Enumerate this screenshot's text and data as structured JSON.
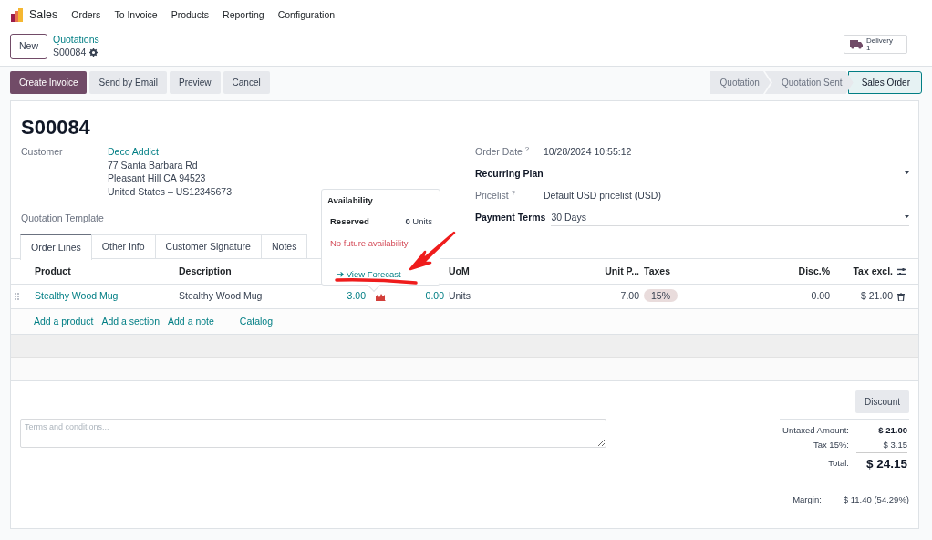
{
  "navbar": {
    "app": "Sales",
    "menus": [
      "Orders",
      "To Invoice",
      "Products",
      "Reporting",
      "Configuration"
    ]
  },
  "control_panel": {
    "new_button": "New",
    "breadcrumb": "Quotations",
    "record": "S00084",
    "smart_button": {
      "label": "Delivery",
      "count": "1"
    }
  },
  "actions": [
    {
      "label": "Create Invoice",
      "primary": true
    },
    {
      "label": "Send by Email",
      "primary": false
    },
    {
      "label": "Preview",
      "primary": false
    },
    {
      "label": "Cancel",
      "primary": false
    }
  ],
  "statusbar": [
    {
      "label": "Quotation",
      "selected": false
    },
    {
      "label": "Quotation Sent",
      "selected": false
    },
    {
      "label": "Sales Order",
      "selected": true
    }
  ],
  "title": "S00084",
  "left_fields": [
    {
      "label": "Customer",
      "link": "Deco Addict",
      "lines": [
        "77 Santa Barbara Rd",
        "Pleasant Hill CA 94523",
        "United States – US12345673"
      ]
    },
    {
      "label": "Quotation Template"
    }
  ],
  "right_fields": [
    {
      "label": "Order Date",
      "help": "?",
      "required": false,
      "kind": "readonly",
      "value": "10/28/2024 10:55:12"
    },
    {
      "label": "Recurring Plan",
      "required": true,
      "kind": "select"
    },
    {
      "label": "Pricelist",
      "help": "?",
      "required": false,
      "kind": "readonly",
      "value": "Default USD pricelist (USD)"
    },
    {
      "label": "Payment Terms",
      "required": true,
      "kind": "select",
      "value": "30 Days"
    }
  ],
  "tabs": [
    {
      "label": "Order Lines",
      "selected": true
    },
    {
      "label": "Other Info",
      "selected": false
    },
    {
      "label": "Customer Signature",
      "selected": false
    },
    {
      "label": "Notes",
      "selected": false
    }
  ],
  "columns": [
    "Product",
    "Description",
    "UoM",
    "Unit P...",
    "Taxes",
    "Disc.%",
    "Tax excl."
  ],
  "rows": [
    {
      "product": "Stealthy Wood Mug",
      "description": "Stealthy Wood Mug",
      "quantity": "3.00",
      "invoiced": "0.00",
      "uom": "Units",
      "unit_price": "7.00",
      "taxes": [
        "15%"
      ],
      "discount": "0.00",
      "subtotal": "$ 21.00"
    }
  ],
  "add_links": [
    "Add a product",
    "Add a section",
    "Add a note",
    "Catalog"
  ],
  "popover": {
    "title": "Availability",
    "reserved_label": "Reserved",
    "reserved_qty": "0",
    "reserved_unit": "Units",
    "message": "No future availability",
    "link": "➔ View Forecast"
  },
  "notes": {
    "placeholder": "Terms and conditions..."
  },
  "discount_button": "Discount",
  "totals": [
    {
      "label": "Untaxed Amount:",
      "value": "$ 21.00",
      "kind": "subtotal"
    },
    {
      "label": "Tax 15%:",
      "value": "$ 3.15",
      "kind": "tax"
    },
    {
      "label": "Total:",
      "value": "$ 24.15",
      "kind": "total"
    }
  ],
  "margin": {
    "label": "Margin:",
    "value": "$ 11.40 (54.29%)"
  }
}
